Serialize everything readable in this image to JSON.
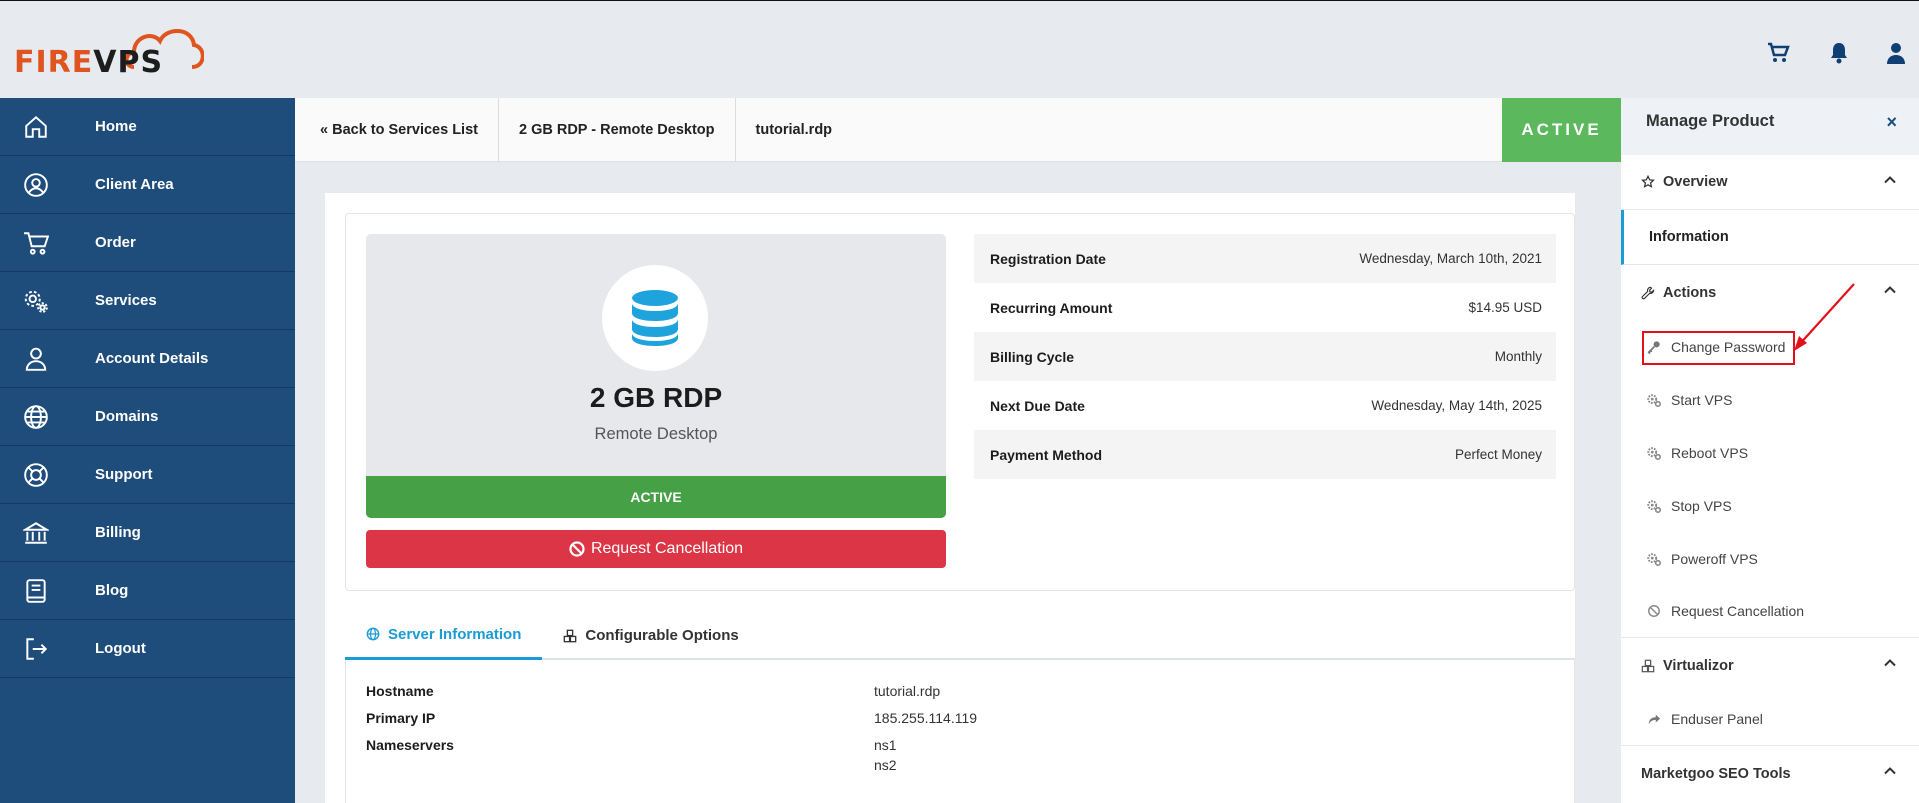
{
  "brand": {
    "logo_fire": "FIRE",
    "logo_vps": "VPS"
  },
  "topbar": {
    "icons": [
      "cart-icon",
      "bell-icon",
      "user-icon"
    ]
  },
  "sidebar": {
    "items": [
      {
        "label": "Home",
        "icon": "home-icon"
      },
      {
        "label": "Client Area",
        "icon": "user-circle-icon"
      },
      {
        "label": "Order",
        "icon": "cart-icon"
      },
      {
        "label": "Services",
        "icon": "gears-icon"
      },
      {
        "label": "Account Details",
        "icon": "user-icon"
      },
      {
        "label": "Domains",
        "icon": "globe-icon"
      },
      {
        "label": "Support",
        "icon": "lifebuoy-icon"
      },
      {
        "label": "Billing",
        "icon": "bank-icon"
      },
      {
        "label": "Blog",
        "icon": "book-icon"
      },
      {
        "label": "Logout",
        "icon": "logout-icon"
      }
    ]
  },
  "breadcrumb": {
    "back": "« Back to Services List",
    "product": "2 GB RDP - Remote Desktop",
    "domain": "tutorial.rdp",
    "status": "ACTIVE"
  },
  "product": {
    "name": "2 GB RDP",
    "group": "Remote Desktop",
    "status": "ACTIVE",
    "cancel_label": "Request Cancellation"
  },
  "details": [
    {
      "label": "Registration Date",
      "value": "Wednesday, March 10th, 2021"
    },
    {
      "label": "Recurring Amount",
      "value": "$14.95 USD"
    },
    {
      "label": "Billing Cycle",
      "value": "Monthly"
    },
    {
      "label": "Next Due Date",
      "value": "Wednesday, May 14th, 2025"
    },
    {
      "label": "Payment Method",
      "value": "Perfect Money"
    }
  ],
  "tabs": [
    {
      "label": "Server Information",
      "active": true
    },
    {
      "label": "Configurable Options",
      "active": false
    }
  ],
  "server_info": {
    "hostname_label": "Hostname",
    "hostname": "tutorial.rdp",
    "ip_label": "Primary IP",
    "ip": "185.255.114.119",
    "ns_label": "Nameservers",
    "ns1": "ns1",
    "ns2": "ns2"
  },
  "manage": {
    "title": "Manage Product",
    "close": "×",
    "overview": "Overview",
    "information": "Information",
    "actions": "Actions",
    "action_items": [
      "Change Password",
      "Start VPS",
      "Reboot VPS",
      "Stop VPS",
      "Poweroff VPS",
      "Request Cancellation"
    ],
    "virtualizor": "Virtualizor",
    "enduser_panel": "Enduser Panel",
    "marketgoo": "Marketgoo SEO Tools"
  },
  "colors": {
    "sidebar": "#1e4c7b",
    "active_green": "#5cb85c",
    "cancel_red": "#dc3545",
    "accent_blue": "#1a9ad6",
    "highlight": "#e3101b"
  }
}
